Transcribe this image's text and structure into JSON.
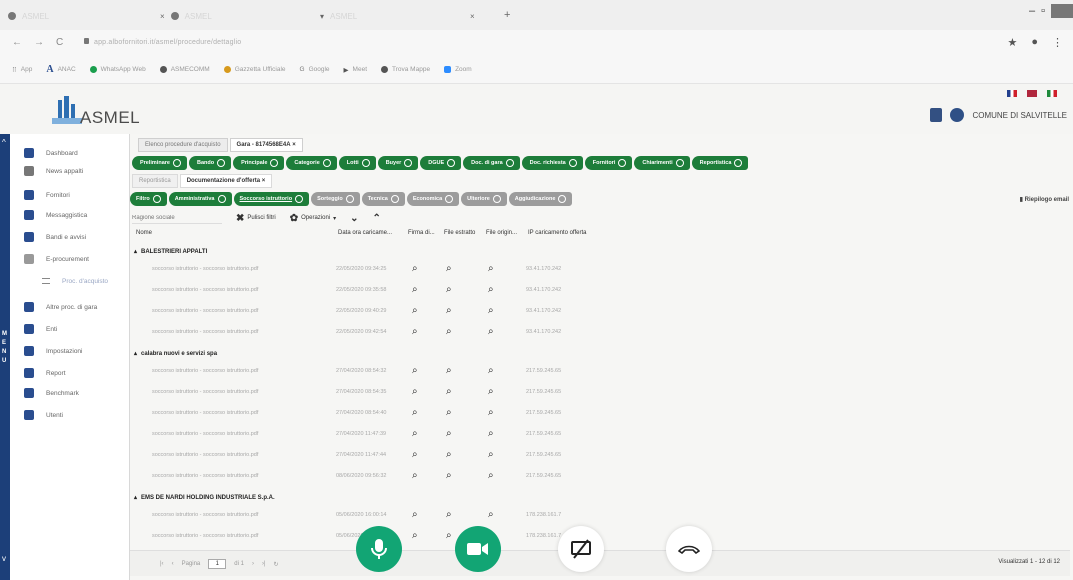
{
  "browser": {
    "tabs": [
      {
        "label": "ASMEL"
      },
      {
        "label": "ASMEL"
      },
      {
        "label": "ASMEL"
      },
      {
        "label": "ASMEL"
      }
    ],
    "url": "app.albofornitori.it/asmel/procedure/dettaglio",
    "bookmarks": [
      "App",
      "ANAC",
      "WhatsApp Web",
      "ASMECOMM",
      "Gazzetta Ufficiale",
      "Google",
      "Meet",
      "Trova Mappe",
      "Zoom"
    ]
  },
  "header": {
    "logo_text": "ASMEL",
    "user_label": "COMUNE DI SALVITELLE"
  },
  "sidebar": {
    "items": [
      {
        "label": "Dashboard",
        "icon": "home-icon",
        "color": "#2a4d8f"
      },
      {
        "label": "News appalti",
        "icon": "news-icon",
        "color": "#777777"
      },
      {
        "label": "Fornitori",
        "icon": "truck-icon",
        "color": "#2a4d8f"
      },
      {
        "label": "Messaggistica",
        "icon": "envelope-icon",
        "color": "#2a4d8f"
      },
      {
        "label": "Bandi e avvisi",
        "icon": "megaphone-icon",
        "color": "#2a4d8f"
      },
      {
        "label": "E-procurement",
        "icon": "cart-icon",
        "color": "#999999"
      },
      {
        "label": "Proc. d'acquisto",
        "icon": "list-icon",
        "color": "#9aa7c4"
      },
      {
        "label": "Altre proc. di gara",
        "icon": "folder-icon",
        "color": "#2a4d8f"
      },
      {
        "label": "Enti",
        "icon": "users-icon",
        "color": "#2a4d8f"
      },
      {
        "label": "Impostazioni",
        "icon": "gear-icon",
        "color": "#2a4d8f"
      },
      {
        "label": "Report",
        "icon": "chart-icon",
        "color": "#2a4d8f"
      },
      {
        "label": "Benchmark",
        "icon": "document-icon",
        "color": "#2a4d8f"
      },
      {
        "label": "Utenti",
        "icon": "user-icon",
        "color": "#2a4d8f"
      }
    ]
  },
  "main": {
    "top_tabs": [
      {
        "label": "Elenco procedure d'acquisto",
        "active": false
      },
      {
        "label": "Gara - 8174568E4A",
        "active": true
      }
    ],
    "steps": [
      "Preliminare",
      "Bando",
      "Principale",
      "Categorie",
      "Lotti",
      "Buyer",
      "DGUE",
      "Doc. di gara",
      "Doc. richiesta",
      "Fornitori",
      "Chiarimenti",
      "Reportistica"
    ],
    "doc_tabs": [
      {
        "label": "Reportistica",
        "active": false
      },
      {
        "label": "Documentazione d'offerta",
        "active": true
      }
    ],
    "sub_steps": [
      {
        "label": "Filtro",
        "state": "done"
      },
      {
        "label": "Amministrativa",
        "state": "done"
      },
      {
        "label": "Soccorso istruttorio",
        "state": "current"
      },
      {
        "label": "Sorteggio",
        "state": "pending"
      },
      {
        "label": "Tecnica",
        "state": "pending"
      },
      {
        "label": "Economica",
        "state": "pending"
      },
      {
        "label": "Ulteriore",
        "state": "pending"
      },
      {
        "label": "Aggiudicazione",
        "state": "pending"
      }
    ],
    "toolbar": {
      "search_placeholder": "Ragione sociale",
      "clear_filters": "Pulisci filtri",
      "operations": "Operazioni"
    },
    "columns": [
      "Nome",
      "Data ora caricame...",
      "Firma di...",
      "File estratto",
      "File origin...",
      "IP caricamento offerta"
    ],
    "groups": [
      {
        "name": "BALESTRIERI APPALTI",
        "rows": [
          {
            "file": "soccorso istruttorio - soccorso istruttorio.pdf",
            "date": "22/05/2020 09:34:25",
            "ip": "93.41.170.242"
          },
          {
            "file": "soccorso istruttorio - soccorso istruttorio.pdf",
            "date": "22/05/2020 09:35:58",
            "ip": "93.41.170.242"
          },
          {
            "file": "soccorso istruttorio - soccorso istruttorio.pdf",
            "date": "22/05/2020 09:40:29",
            "ip": "93.41.170.242"
          },
          {
            "file": "soccorso istruttorio - soccorso istruttorio.pdf",
            "date": "22/05/2020 09:42:54",
            "ip": "93.41.170.242"
          }
        ]
      },
      {
        "name": "calabra nuovi e servizi spa",
        "rows": [
          {
            "file": "soccorso istruttorio - soccorso istruttorio.pdf",
            "date": "27/04/2020 08:54:32",
            "ip": "217.59.245.65"
          },
          {
            "file": "soccorso istruttorio - soccorso istruttorio.pdf",
            "date": "27/04/2020 08:54:35",
            "ip": "217.59.245.65"
          },
          {
            "file": "soccorso istruttorio - soccorso istruttorio.pdf",
            "date": "27/04/2020 08:54:40",
            "ip": "217.59.245.65"
          },
          {
            "file": "soccorso istruttorio - soccorso istruttorio.pdf",
            "date": "27/04/2020 11:47:39",
            "ip": "217.59.245.65"
          },
          {
            "file": "soccorso istruttorio - soccorso istruttorio.pdf",
            "date": "27/04/2020 11:47:44",
            "ip": "217.59.245.65"
          },
          {
            "file": "soccorso istruttorio - soccorso istruttorio.pdf",
            "date": "08/06/2020 09:56:32",
            "ip": "217.59.245.65"
          }
        ]
      },
      {
        "name": "EMS DE NARDI HOLDING INDUSTRIALE S.p.A.",
        "rows": [
          {
            "file": "soccorso istruttorio - soccorso istruttorio.pdf",
            "date": "05/06/2020 16:00:14",
            "ip": "178.238.161.7"
          },
          {
            "file": "soccorso istruttorio - soccorso istruttorio.pdf",
            "date": "05/06/2020 16:02:10",
            "ip": "178.238.161.7"
          }
        ]
      }
    ]
  },
  "right_panel": {
    "title": "Riepilogo email"
  },
  "pager": {
    "page_label": "Pagina",
    "page_value": "1",
    "of_label": "di 1",
    "right_label": "Visualizzati 1 - 12 di 12"
  },
  "meeting": {
    "mic": "microphone-icon",
    "cam": "camera-icon",
    "share": "screen-share-off-icon",
    "hangup": "hangup-icon"
  }
}
